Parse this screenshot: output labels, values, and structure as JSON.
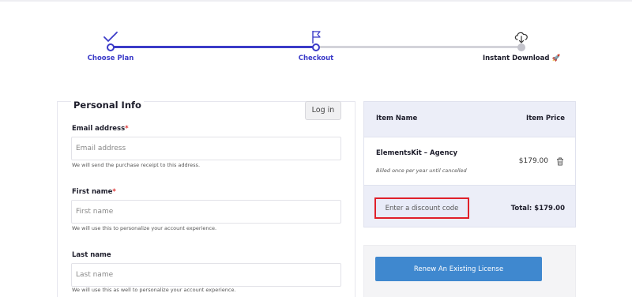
{
  "stepper": {
    "steps": [
      {
        "label": "Choose Plan",
        "icon": "check-icon"
      },
      {
        "label": "Checkout",
        "icon": "flag-icon"
      },
      {
        "label": "Instant Download",
        "icon": "cloud-download-icon",
        "suffix": "🚀"
      }
    ],
    "accent": "#3b3bc8"
  },
  "form": {
    "title": "Personal Info",
    "login_label": "Log in",
    "fields": [
      {
        "label": "Email address",
        "required": "*",
        "placeholder": "Email address",
        "help": "We will send the purchase receipt to this address."
      },
      {
        "label": "First name",
        "required": "*",
        "placeholder": "First name",
        "help": "We will use this to personalize your account experience."
      },
      {
        "label": "Last name",
        "required": "",
        "placeholder": "Last name",
        "help": "We will use this as well to personalize your account experience."
      }
    ]
  },
  "summary": {
    "col_item": "Item Name",
    "col_price": "Item Price",
    "item_name": "ElementsKit – Agency",
    "item_billing": "Billed once per year until cancelled",
    "item_price": "$179.00",
    "discount_placeholder": "Enter a discount code",
    "total": "Total: $179.00"
  },
  "renew": {
    "label": "Renew An Existing License",
    "color": "#3f88cf"
  }
}
